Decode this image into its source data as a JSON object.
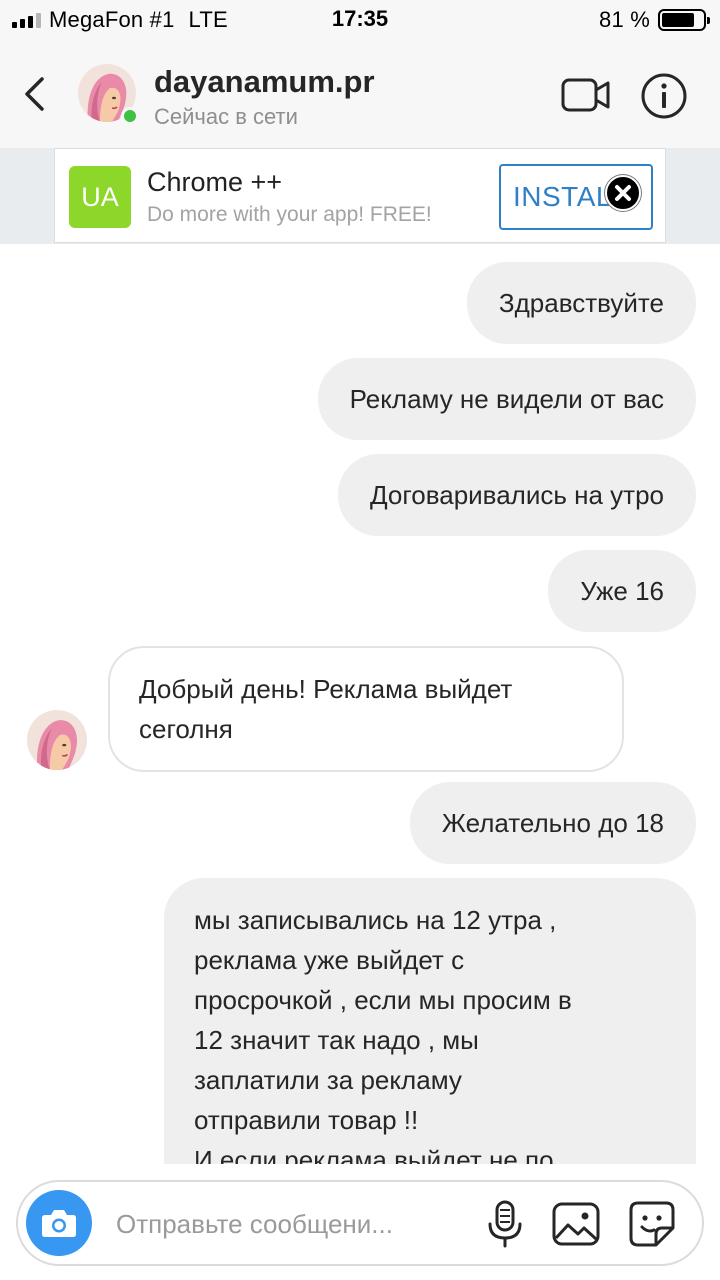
{
  "status_bar": {
    "carrier": "MegaFon #1",
    "network": "LTE",
    "time": "17:35",
    "battery_text": "81 %",
    "battery_level": 0.81
  },
  "header": {
    "username": "dayanamum.pr",
    "status": "Сейчас в сети",
    "online_color": "#3ec143"
  },
  "ad": {
    "logo_text": "UA",
    "title": "Chrome ++",
    "subtitle": "Do more with your app! FREE!",
    "install_label": "INSTALL",
    "accent": "#2f80c7",
    "logo_color": "#8dd62a"
  },
  "messages": [
    {
      "from": "me",
      "text": "Здравствуйте"
    },
    {
      "from": "me",
      "text": "Рекламу не видели от вас"
    },
    {
      "from": "me",
      "text": "Договаривались на утро"
    },
    {
      "from": "me",
      "text": "Уже 16"
    },
    {
      "from": "them",
      "lines": [
        "Добрый день! Реклама выйдет",
        "сеголня"
      ]
    },
    {
      "from": "me",
      "text": "Желательно до 18"
    },
    {
      "from": "me",
      "lines": [
        "мы записывались на 12 утра ,",
        "реклама уже выйдет с",
        "просрочкой , если мы просим в",
        "12 значит так надо , мы",
        "заплатили за рекламу",
        "отправили товар !!",
        "И если реклама выйдет не по"
      ]
    }
  ],
  "composer": {
    "placeholder": "Отправьте сообщени..."
  },
  "icons": {
    "back": "chevron-left-icon",
    "video": "video-camera-icon",
    "info": "info-icon",
    "ad_close": "close-icon",
    "camera": "camera-icon",
    "mic": "microphone-icon",
    "gallery": "image-icon",
    "sticker": "sticker-icon"
  }
}
